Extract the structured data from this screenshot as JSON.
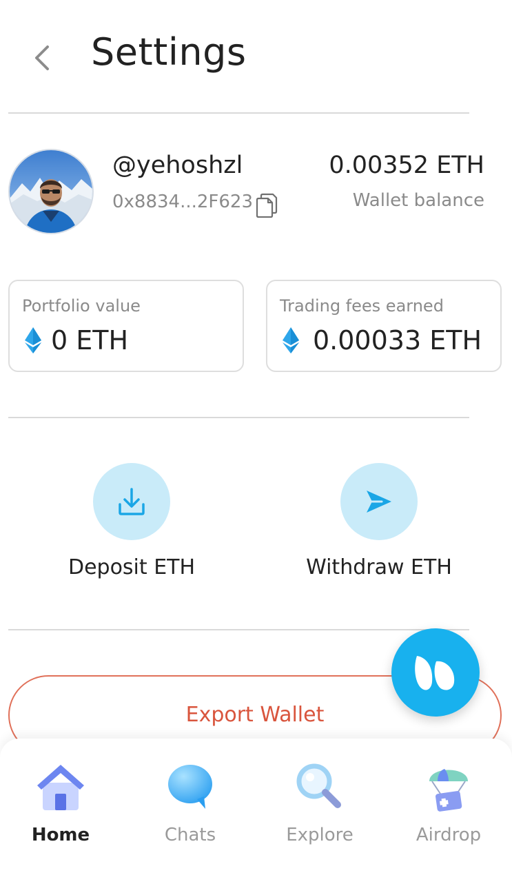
{
  "header": {
    "title": "Settings"
  },
  "profile": {
    "username": "@yehoshzl",
    "address": "0x8834...2F623",
    "balance": "0.00352 ETH",
    "balance_label": "Wallet balance"
  },
  "stats": [
    {
      "label": "Portfolio value",
      "value": "0 ETH"
    },
    {
      "label": "Trading fees earned",
      "value": "0.00033 ETH"
    }
  ],
  "actions": {
    "deposit_label": "Deposit ETH",
    "withdraw_label": "Withdraw ETH"
  },
  "export": {
    "label": "Export Wallet"
  },
  "nav": [
    {
      "label": "Home",
      "icon": "home-icon",
      "active": true
    },
    {
      "label": "Chats",
      "icon": "chat-bubble-icon",
      "active": false
    },
    {
      "label": "Explore",
      "icon": "magnifier-icon",
      "active": false
    },
    {
      "label": "Airdrop",
      "icon": "parachute-gift-icon",
      "active": false
    }
  ],
  "colors": {
    "accent": "#18b1ee",
    "action_bg": "#c9ebf9",
    "export_red": "#d9553d",
    "eth_blue": "#1ea0e6"
  }
}
